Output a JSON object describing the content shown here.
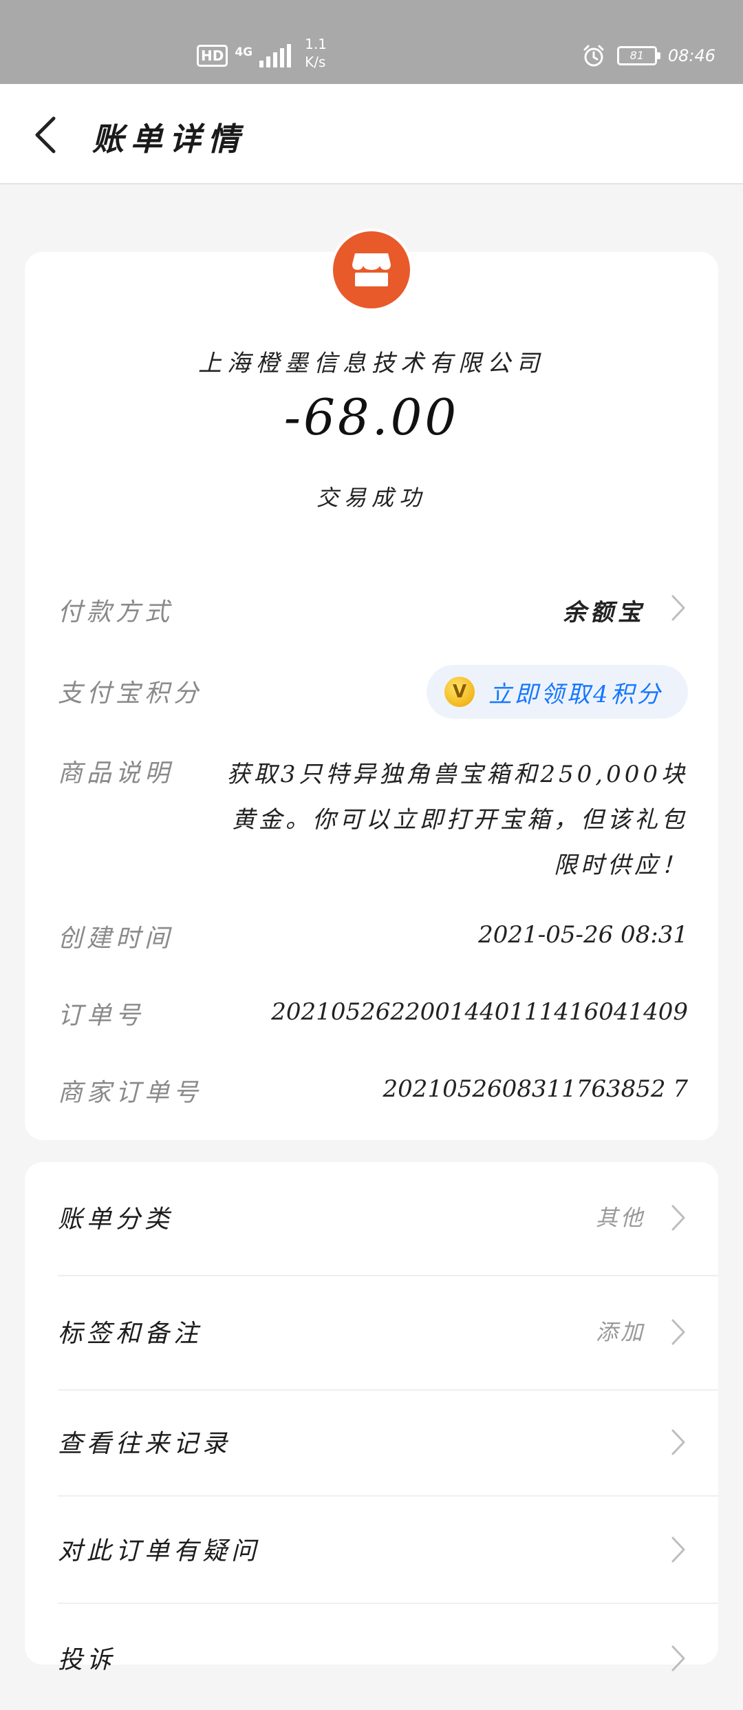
{
  "status_bar": {
    "hd": "HD",
    "network": "4G",
    "speed_value": "1.1",
    "speed_unit": "K/s",
    "battery": "81",
    "time": "08:46"
  },
  "header": {
    "title": "账单详情"
  },
  "bill": {
    "merchant": "上海橙墨信息技术有限公司",
    "amount": "-68.00",
    "status": "交易成功"
  },
  "details": {
    "payment_method_label": "付款方式",
    "payment_method_value": "余额宝",
    "points_label": "支付宝积分",
    "points_coin": "V",
    "points_action": "立即领取4积分",
    "description_label": "商品说明",
    "description_value": "获取3只特异独角兽宝箱和250,000块黄金。你可以立即打开宝箱，但该礼包限时供应！",
    "created_label": "创建时间",
    "created_value": "2021-05-26 08:31",
    "order_no_label": "订单号",
    "order_no_value": "2021052622001440111416041409",
    "merchant_order_label": "商家订单号",
    "merchant_order_value": "2021052608311763852 7"
  },
  "actions": [
    {
      "label": "账单分类",
      "value": "其他"
    },
    {
      "label": "标签和备注",
      "value": "添加"
    },
    {
      "label": "查看往来记录",
      "value": ""
    },
    {
      "label": "对此订单有疑问",
      "value": ""
    },
    {
      "label": "投诉",
      "value": ""
    }
  ],
  "colors": {
    "accent_blue": "#1677ff",
    "merchant_orange": "#e85a2a",
    "status_bar": "#a9a9a9"
  }
}
